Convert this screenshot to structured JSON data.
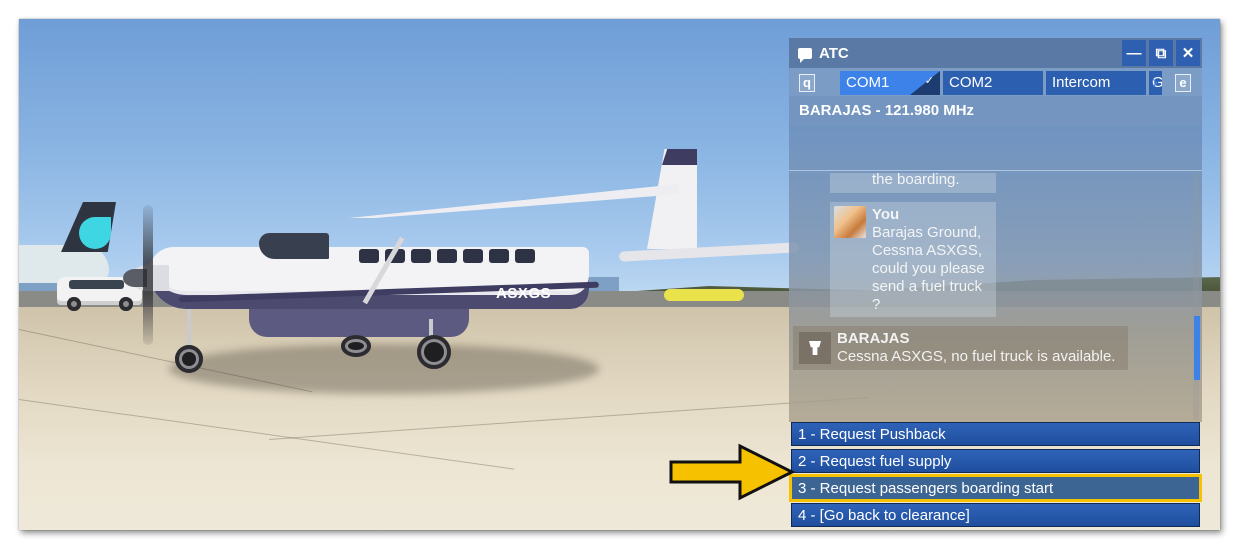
{
  "scene": {
    "aircraft_registration": "ASXGS"
  },
  "atc_window": {
    "title": "ATC",
    "icons": {
      "title": "chat-bubble-icon",
      "minimize": "minimize-icon",
      "popout": "popout-icon",
      "close": "close-icon",
      "active_tab": "checkmark-icon",
      "scroll_right": "chevron-right-icon",
      "tower": "control-tower-icon",
      "avatar": "shiba-inu-avatar"
    },
    "window_buttons": {
      "minimize": "—",
      "popout": "⧉",
      "close": "✕"
    },
    "tabs": {
      "prev_key": "q",
      "next_key": "e",
      "items": [
        {
          "label": "COM1",
          "active": true
        },
        {
          "label": "COM2",
          "active": false
        },
        {
          "label": "Intercom",
          "active": false
        },
        {
          "label": "G",
          "active": false
        }
      ],
      "check_mark": "✓",
      "chevron": "›"
    },
    "frequency": "BARAJAS - 121.980 MHz",
    "messages": [
      {
        "sender": "",
        "text": "the boarding.",
        "partial": true
      },
      {
        "sender": "You",
        "text": "Barajas Ground, Cessna ASXGS, could you please send a fuel truck ?"
      },
      {
        "sender": "BARAJAS",
        "text": "Cessna ASXGS, no fuel truck is available."
      }
    ],
    "options": [
      {
        "label": "1 - Request Pushback",
        "highlighted": false
      },
      {
        "label": "2 - Request fuel supply",
        "highlighted": false
      },
      {
        "label": "3 - Request passengers boarding start",
        "highlighted": true
      },
      {
        "label": "4 - [Go back to clearance]",
        "highlighted": false
      }
    ],
    "colors": {
      "accent": "#3d82e8",
      "tab": "#2c5fb0",
      "highlight": "#f6c200"
    }
  },
  "annotation": {
    "icon": "yellow-arrow-icon",
    "color": "#f6c200"
  }
}
